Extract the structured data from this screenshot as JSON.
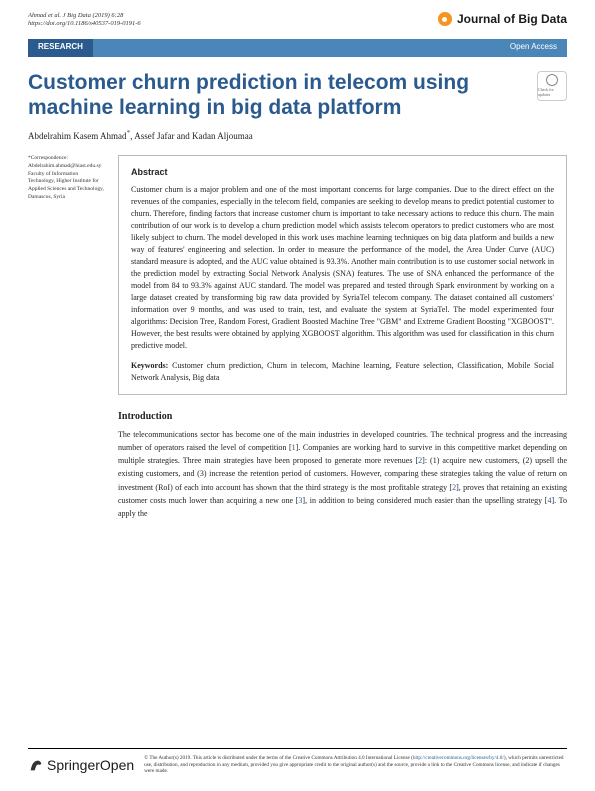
{
  "header": {
    "citation": "Ahmad et al. J Big Data            (2019) 6:28 ",
    "doi": "https://doi.org/10.1186/s40537-019-0191-6",
    "journal": "Journal of Big Data"
  },
  "banner": {
    "left": "RESEARCH",
    "right": "Open Access"
  },
  "title": "Customer churn prediction in telecom using machine learning in big data platform",
  "badge": "Check for updates",
  "authors": {
    "a1": "Abdelrahim Kasem Ahmad",
    "sup1": "*",
    "a2": ", Assef Jafar and Kadan Aljoumaa"
  },
  "sidebar": {
    "corr_label": "*Correspondence:",
    "email": "Abdelrahim.ahmad@hiast.edu.sy",
    "affil": "Faculty of Information Technology, Higher Institute for Applied Sciences and Technology, Damascus, Syria"
  },
  "abstract": {
    "heading": "Abstract",
    "body": "Customer churn is a major problem and one of the most important concerns for large companies. Due to the direct effect on the revenues of the companies, especially in the telecom field, companies are seeking to develop means to predict potential customer to churn. Therefore, finding factors that increase customer churn is important to take necessary actions to reduce this churn. The main contribution of our work is to develop a churn prediction model which assists telecom operators to predict customers who are most likely subject to churn. The model developed in this work uses machine learning techniques on big data platform and builds a new way of features' engineering and selection. In order to measure the performance of the model, the Area Under Curve (AUC) standard measure is adopted, and the AUC value obtained is 93.3%. Another main contribution is to use customer social network in the prediction model by extracting Social Network Analysis (SNA) features. The use of SNA enhanced the performance of the model from 84 to 93.3% against AUC standard. The model was prepared and tested through Spark environment by working on a large dataset created by transforming big raw data provided by SyriaTel telecom company. The dataset contained all customers' information over 9 months, and was used to train, test, and evaluate the system at SyriaTel. The model experimented four algorithms: Decision Tree, Random Forest, Gradient Boosted Machine Tree \"GBM\" and Extreme Gradient Boosting \"XGBOOST\". However, the best results were obtained by applying XGBOOST algorithm. This algorithm was used for classification in this churn predictive model.",
    "kw_label": "Keywords:",
    "kw": " Customer churn prediction, Churn in telecom, Machine learning, Feature selection, Classification, Mobile Social Network Analysis, Big data"
  },
  "intro": {
    "heading": "Introduction",
    "p1a": "The telecommunications sector has become one of the main industries in developed countries. The technical progress and the increasing number of operators raised the level of competition [",
    "r1": "1",
    "p1b": "]. Companies are working hard to survive in this competitive market depending on multiple strategies. Three main strategies have been proposed to generate more revenues [",
    "r2": "2",
    "p1c": "]: (1) acquire new customers, (2) upsell the existing customers, and (3) increase the retention period of customers. However, comparing these strategies taking the value of return on investment (RoI) of each into account has shown that the third strategy is the most profitable strategy [",
    "r3": "2",
    "p1d": "], proves that retaining an existing customer costs much lower than acquiring a new one [",
    "r4": "3",
    "p1e": "], in addition to being considered much easier than the upselling strategy [",
    "r5": "4",
    "p1f": "]. To apply the"
  },
  "footer": {
    "brand": "SpringerOpen",
    "t1": "© The Author(s) 2019. This article is distributed under the terms of the Creative Commons Attribution 4.0 International License (",
    "link": "http://creativecommons.org/licenses/by/4.0/",
    "t2": "), which permits unrestricted use, distribution, and reproduction in any medium, provided you give appropriate credit to the original author(s) and the source, provide a link to the Creative Commons license, and indicate if changes were made."
  }
}
